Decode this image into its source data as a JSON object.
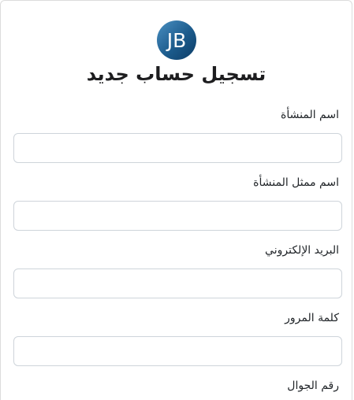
{
  "logo": {
    "text": "JB",
    "colors": {
      "dark": "#0d3c66",
      "light": "#4a90c2"
    }
  },
  "form": {
    "title": "تسجيل حساب جديد",
    "fields": [
      {
        "label": "اسم المنشأة",
        "value": "",
        "placeholder": ""
      },
      {
        "label": "اسم ممثل المنشأة",
        "value": "",
        "placeholder": ""
      },
      {
        "label": "البريد الإلكتروني",
        "value": "",
        "placeholder": ""
      },
      {
        "label": "كلمة المرور",
        "value": "",
        "placeholder": ""
      },
      {
        "label": "رقم الجوال",
        "value": "",
        "placeholder": ""
      }
    ]
  }
}
